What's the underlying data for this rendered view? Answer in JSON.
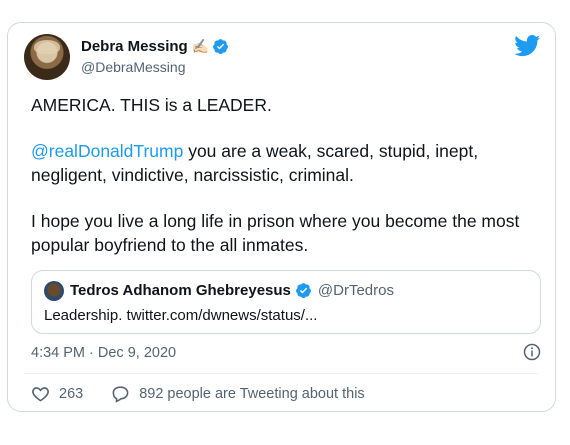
{
  "author": {
    "name": "Debra Messing",
    "emoji": "✍🏻",
    "handle": "@DebraMessing"
  },
  "tweet": {
    "line1": "AMERICA.   THIS is a LEADER.",
    "mention": "@realDonaldTrump",
    "line2_rest": " you are a weak, scared, stupid, inept, negligent, vindictive, narcissistic, criminal.",
    "line3": "I hope you live a long life in prison where you become the most popular boyfriend to the all inmates."
  },
  "quote": {
    "name": "Tedros Adhanom Ghebreyesus",
    "handle": "@DrTedros",
    "text": "Leadership. twitter.com/dwnews/status/..."
  },
  "timestamp": "4:34 PM · Dec 9, 2020",
  "stats": {
    "likes": "263",
    "tweeting": "892 people are Tweeting about this"
  },
  "colors": {
    "accent": "#1d9bf0",
    "muted": "#536471",
    "border": "#cfd9de"
  },
  "icons": [
    "twitter-bird-icon",
    "verified-badge-icon",
    "info-icon",
    "heart-icon",
    "reply-bubble-icon"
  ]
}
